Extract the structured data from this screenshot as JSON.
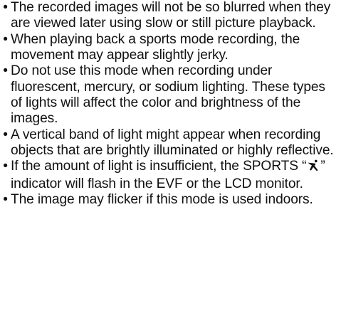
{
  "bullet_glyph": "•",
  "items": [
    {
      "text": "The recorded images will not be so blurred when they are viewed later using slow or still picture playback."
    },
    {
      "text": "When playing back a sports mode recording, the movement may appear slightly jerky."
    },
    {
      "text": "Do not use this mode when recording under fluorescent, mercury, or sodium lighting. These types of lights will affect the color and brightness of the images."
    },
    {
      "text": "A vertical band of light might appear when recording objects that are brightly illuminated or highly reflective."
    },
    {
      "text_before_icon": "If the amount of light is insufficient, the SPORTS “",
      "icon": "sports-runner-icon",
      "text_after_icon": "” indicator will flash in the EVF or the LCD monitor."
    },
    {
      "text": "The image may flicker if this mode is used indoors."
    }
  ]
}
